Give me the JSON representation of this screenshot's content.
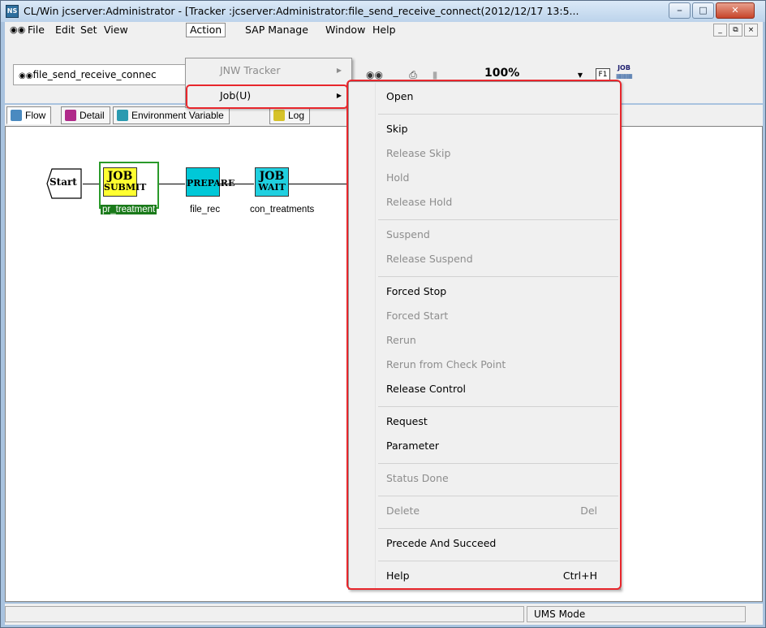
{
  "window": {
    "title": "CL/Win jcserver:Administrator - [Tracker :jcserver:Administrator:file_send_receive_connect(2012/12/17 13:5...",
    "app_icon_text": "NS"
  },
  "menubar": {
    "items": [
      "File",
      "Edit",
      "Set",
      "View",
      "Action",
      "SAP Manage",
      "Window",
      "Help"
    ],
    "active": "Action"
  },
  "toolbar": {
    "flow_name": "file_send_receive_connec",
    "zoom": "100%",
    "f1_label": "F1",
    "job_icon_label": "JOB"
  },
  "tabs": [
    {
      "label": "Flow",
      "active": true
    },
    {
      "label": "Detail",
      "active": false
    },
    {
      "label": "Environment Variable",
      "active": false
    },
    {
      "label": "Log",
      "active": false
    }
  ],
  "flow": {
    "start_label": "Start",
    "nodes": [
      {
        "line1": "JOB",
        "line2": "SUBMIT",
        "label": "pr_treatment",
        "color": "#ffff00",
        "selected": true
      },
      {
        "line1": "",
        "line2": "PREPARE",
        "label": "file_rec",
        "color": "#00c8d8",
        "selected": false
      },
      {
        "line1": "JOB",
        "line2": "WAIT",
        "label": "con_treatments",
        "color": "#20d0e0",
        "selected": false
      }
    ]
  },
  "action_menu": {
    "items": [
      {
        "label": "JNW Tracker",
        "enabled": false
      },
      {
        "label": "Job(U)",
        "enabled": true,
        "highlighted": true
      }
    ]
  },
  "job_menu": {
    "groups": [
      [
        {
          "label": "Open",
          "enabled": true,
          "shortcut": ""
        }
      ],
      [
        {
          "label": "Skip",
          "enabled": true,
          "shortcut": ""
        },
        {
          "label": "Release Skip",
          "enabled": false,
          "shortcut": ""
        },
        {
          "label": "Hold",
          "enabled": false,
          "shortcut": ""
        },
        {
          "label": "Release Hold",
          "enabled": false,
          "shortcut": ""
        }
      ],
      [
        {
          "label": "Suspend",
          "enabled": false,
          "shortcut": ""
        },
        {
          "label": "Release Suspend",
          "enabled": false,
          "shortcut": ""
        }
      ],
      [
        {
          "label": "Forced Stop",
          "enabled": true,
          "shortcut": ""
        },
        {
          "label": "Forced Start",
          "enabled": false,
          "shortcut": ""
        },
        {
          "label": "Rerun",
          "enabled": false,
          "shortcut": ""
        },
        {
          "label": "Rerun from Check Point",
          "enabled": false,
          "shortcut": ""
        },
        {
          "label": "Release Control",
          "enabled": true,
          "shortcut": ""
        }
      ],
      [
        {
          "label": "Request",
          "enabled": true,
          "shortcut": ""
        },
        {
          "label": "Parameter",
          "enabled": true,
          "shortcut": ""
        }
      ],
      [
        {
          "label": "Status Done",
          "enabled": false,
          "shortcut": ""
        }
      ],
      [
        {
          "label": "Delete",
          "enabled": false,
          "shortcut": "Del"
        }
      ],
      [
        {
          "label": "Precede And Succeed",
          "enabled": true,
          "shortcut": ""
        }
      ],
      [
        {
          "label": "Help",
          "enabled": true,
          "shortcut": "Ctrl+H"
        }
      ]
    ]
  },
  "statusbar": {
    "mode": "UMS Mode"
  },
  "colors": {
    "highlight_border": "#e8262c",
    "disabled_text": "#8d8d8d"
  }
}
